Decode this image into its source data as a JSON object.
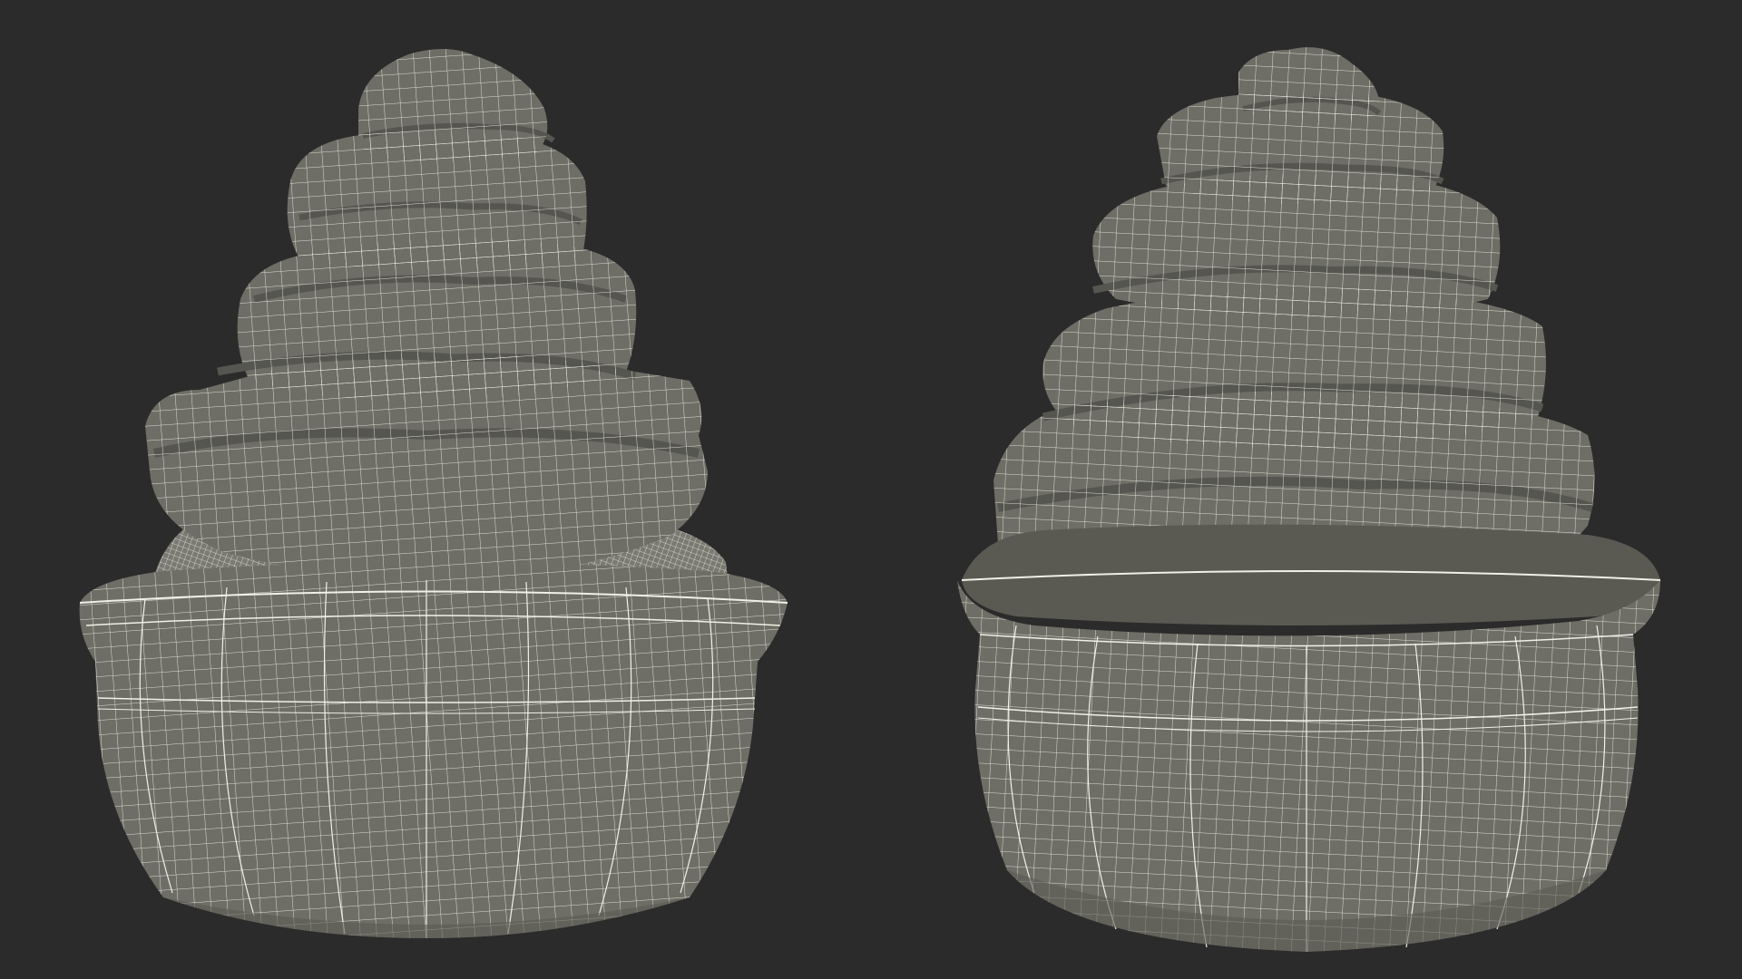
{
  "scene": {
    "background_color": "#2b2b2b",
    "surface_color": "#6e6e66",
    "surface_shade_color": "#5a5a53",
    "wire_color": "#f2f0e6",
    "objects": [
      {
        "name": "dessert-bowl-front-view",
        "view": "front"
      },
      {
        "name": "dessert-bowl-three-quarter-view",
        "view": "three-quarter"
      }
    ]
  }
}
